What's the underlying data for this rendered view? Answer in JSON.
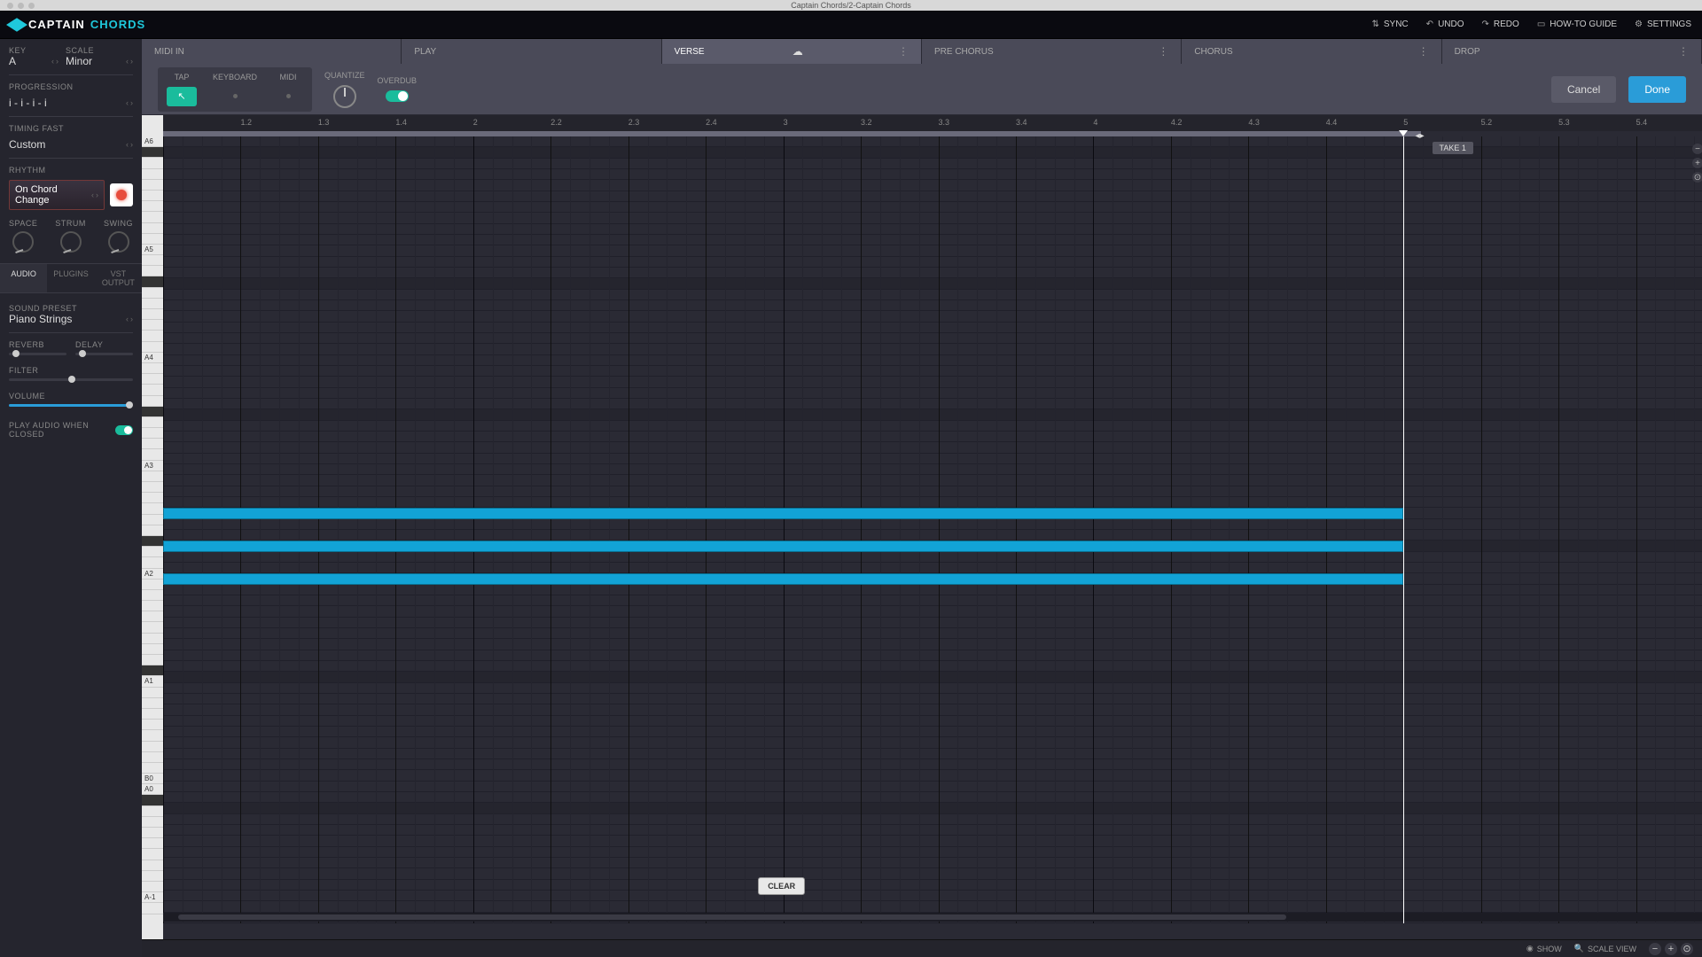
{
  "window": {
    "title": "Captain Chords/2-Captain Chords"
  },
  "logo": {
    "first": "CAPTAIN",
    "second": "CHORDS"
  },
  "appbar": {
    "sync": "SYNC",
    "undo": "UNDO",
    "redo": "REDO",
    "guide": "HOW-TO GUIDE",
    "settings": "SETTINGS"
  },
  "sidebar": {
    "key_label": "KEY",
    "key_value": "A",
    "scale_label": "SCALE",
    "scale_value": "Minor",
    "progression_label": "PROGRESSION",
    "progression_value": "i - i - i - i",
    "timing_label": "TIMING  FAST",
    "timing_value": "Custom",
    "rhythm_label": "RHYTHM",
    "rhythm_value": "On Chord Change",
    "space_label": "SPACE",
    "strum_label": "STRUM",
    "swing_label": "SWING",
    "tabs": {
      "audio": "AUDIO",
      "plugins": "PLUGINS",
      "vst": "VST  OUTPUT"
    },
    "sound_preset_label": "SOUND PRESET",
    "sound_preset_value": "Piano Strings",
    "reverb_label": "REVERB",
    "delay_label": "DELAY",
    "filter_label": "FILTER",
    "volume_label": "VOLUME",
    "play_closed_label": "PLAY AUDIO WHEN CLOSED"
  },
  "sections": {
    "midi_in": "MIDI IN",
    "play": "PLAY",
    "verse": "VERSE",
    "pre_chorus": "PRE CHORUS",
    "chorus": "CHORUS",
    "drop": "DROP"
  },
  "toolbar": {
    "tap": "TAP",
    "keyboard": "KEYBOARD",
    "midi": "MIDI",
    "quantize": "QUANTIZE",
    "overdub": "OVERDUB",
    "cancel": "Cancel",
    "done": "Done"
  },
  "ruler": {
    "ticks": [
      "1.2",
      "1.3",
      "1.4",
      "2",
      "2.2",
      "2.3",
      "2.4",
      "3",
      "3.2",
      "3.3",
      "3.4",
      "4",
      "4.2",
      "4.3",
      "4.4",
      "5",
      "5.2",
      "5.3",
      "5.4"
    ]
  },
  "piano": {
    "labels": {
      "A6": "A6",
      "A5": "A5",
      "A4": "A4",
      "A3": "A3",
      "A2": "A2",
      "A1": "A1",
      "B0": "B0",
      "A0": "A0",
      "Am1": "A-1"
    }
  },
  "take": "TAKE 1",
  "clear": "CLEAR",
  "bottombar": {
    "show": "SHOW",
    "scale_view": "SCALE VIEW"
  }
}
